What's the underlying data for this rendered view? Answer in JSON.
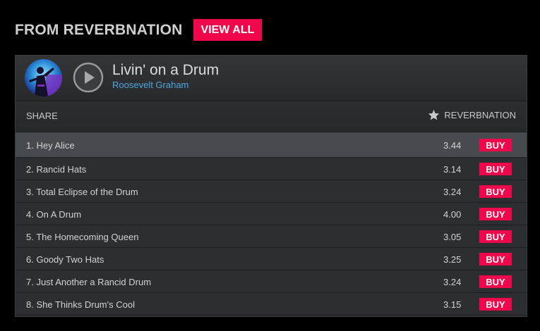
{
  "header": {
    "title": "FROM REVERBNATION",
    "view_all_label": "VIEW ALL"
  },
  "player": {
    "track_title": "Livin' on a Drum",
    "artist": "Roosevelt Graham",
    "avatar_icon": "artist-avatar",
    "play_icon": "play-icon"
  },
  "toolbar": {
    "share_label": "SHARE",
    "reverbnation_label": "REVERBNATION",
    "star_icon": "star-icon"
  },
  "tracks": [
    {
      "name": "1. Hey Alice",
      "price": "3.44",
      "buy": "BUY",
      "active": true
    },
    {
      "name": "2. Rancid Hats",
      "price": "3.14",
      "buy": "BUY"
    },
    {
      "name": "3. Total Eclipse of the Drum",
      "price": "3.24",
      "buy": "BUY"
    },
    {
      "name": "4. On A Drum",
      "price": "4.00",
      "buy": "BUY"
    },
    {
      "name": "5. The Homecoming Queen",
      "price": "3.05",
      "buy": "BUY"
    },
    {
      "name": "6. Goody Two Hats",
      "price": "3.25",
      "buy": "BUY"
    },
    {
      "name": "7. Just Another a Rancid Drum",
      "price": "3.24",
      "buy": "BUY"
    },
    {
      "name": "8. She Thinks Drum's Cool",
      "price": "3.15",
      "buy": "BUY"
    }
  ],
  "colors": {
    "accent": "#f0064a",
    "artist_link": "#4fa7e0",
    "background": "#000000",
    "panel": "#2a2c2e"
  }
}
